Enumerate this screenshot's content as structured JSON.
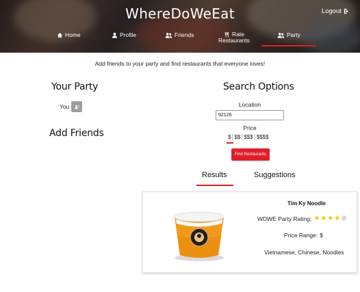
{
  "header": {
    "brand": "WhereDoWeEat",
    "logout_label": "Logout",
    "nav": [
      {
        "label": "Home",
        "icon": "home-icon"
      },
      {
        "label": "Profile",
        "icon": "user-icon"
      },
      {
        "label": "Friends",
        "icon": "users-icon"
      },
      {
        "label_line1": "Rate",
        "label_line2": "Restaurants",
        "icon": "utensils-icon"
      },
      {
        "label": "Party",
        "icon": "users-icon",
        "active": true
      }
    ],
    "accent": "#e02020"
  },
  "tagline": "Add friends to your party and find restaurants that everyone loves!",
  "party": {
    "title": "Your Party",
    "members": [
      {
        "name": "You",
        "icon": "user-card-icon"
      }
    ]
  },
  "add_friends": {
    "title": "Add Friends"
  },
  "search": {
    "title": "Search Options",
    "location_label": "Location",
    "location_value": "92126",
    "price_label": "Price",
    "price_options": [
      "$",
      "$$",
      "$$$",
      "$$$$"
    ],
    "price_selected": "$",
    "find_button": "Find Restaurants"
  },
  "tabs": {
    "results": "Results",
    "suggestions": "Suggestions",
    "active": "Results"
  },
  "result": {
    "name": "Tim Ky Noodle",
    "rating_label": "WDWE Party Rating:",
    "rating": 4,
    "rating_max": 5,
    "price_label": "Price Range:",
    "price_value": "$",
    "cuisines": "Vietnamese, Chinese, Noodles",
    "star_color": "#f2c200"
  }
}
